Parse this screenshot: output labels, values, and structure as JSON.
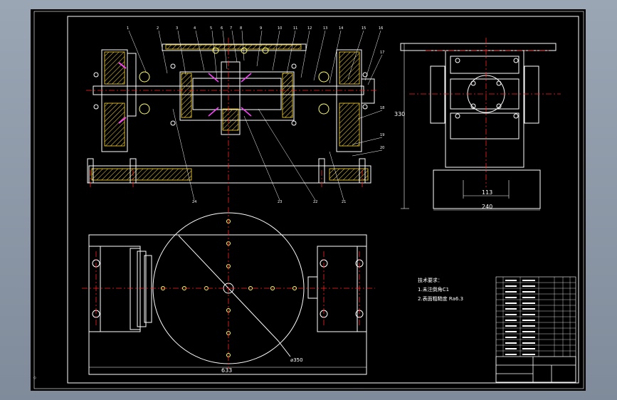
{
  "drawing": {
    "part_numbers": [
      "1",
      "2",
      "3",
      "4",
      "5",
      "6",
      "7",
      "8",
      "9",
      "10",
      "11",
      "12",
      "13",
      "14",
      "15",
      "16",
      "17",
      "18",
      "19",
      "20"
    ],
    "lower_leaders": [
      "24",
      "23",
      "22",
      "21"
    ],
    "side_view": {
      "height_dim": "330",
      "inner_width_dim": "113",
      "width_dim": "240"
    },
    "plan_view": {
      "length_dim": "633",
      "diameter_dim": "⌀350"
    },
    "tech_notes": {
      "title": "技术要求：",
      "line1": "1.未注倒角C1",
      "line2": "2.表面粗糙度 Ra6.3"
    }
  },
  "colors": {
    "background": "#000000",
    "outline": "#ffffff",
    "centerline": "#ff2020",
    "hatch": "#ffdd33",
    "accent": "#ff40ff",
    "detail": "#ffff66",
    "leader": "#ffffff"
  }
}
